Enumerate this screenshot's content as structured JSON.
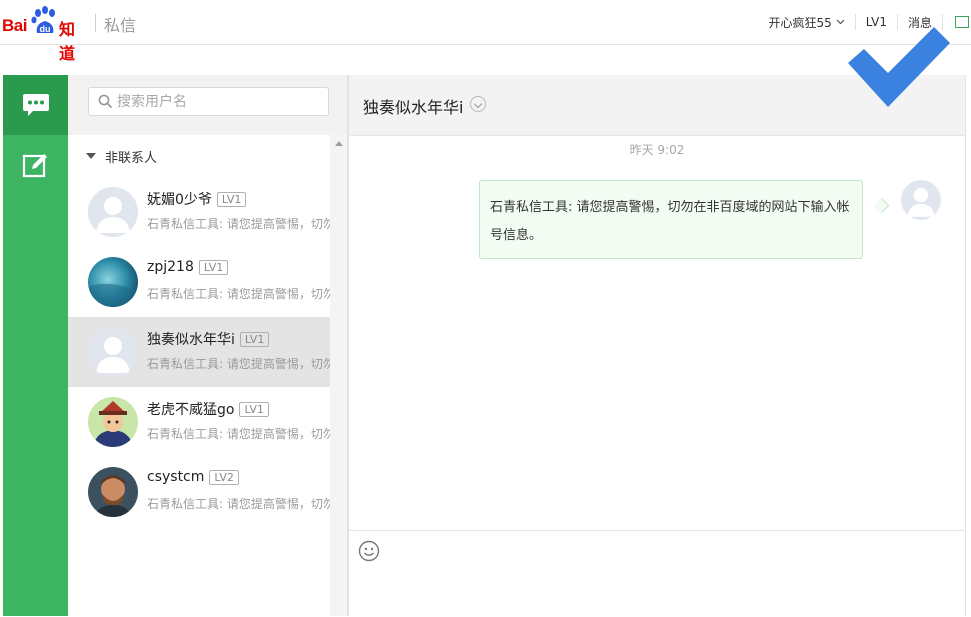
{
  "header": {
    "logo_text_bai": "Bai",
    "logo_text_du": "du",
    "logo_text_zhidao": "知道",
    "section_title": "私信",
    "nav": {
      "username": "开心疯狂55",
      "level": "LV1",
      "messages": "消息"
    }
  },
  "sidebar": {
    "search_placeholder": "搜索用户名",
    "group_label": "非联系人",
    "contacts": [
      {
        "name": "妩媚0少爷",
        "level": "LV1",
        "preview": "石青私信工具: 请您提高警惕，切勿",
        "avatar": "default-avatar"
      },
      {
        "name": "zpj218",
        "level": "LV1",
        "preview": "石青私信工具: 请您提高警惕，切勿",
        "avatar": "blue-photo-avatar"
      },
      {
        "name": "独奏似水年华i",
        "level": "LV1",
        "preview": "石青私信工具: 请您提高警惕，切勿",
        "avatar": "default-avatar"
      },
      {
        "name": "老虎不威猛go",
        "level": "LV1",
        "preview": "石青私信工具: 请您提高警惕，切勿",
        "avatar": "cartoon-avatar"
      },
      {
        "name": "csystcm",
        "level": "LV2",
        "preview": "石青私信工具: 请您提高警惕，切勿",
        "avatar": "photo-avatar"
      }
    ]
  },
  "chat": {
    "title": "独奏似水年华i",
    "timestamp": "昨天 9:02",
    "message": "石青私信工具: 请您提高警惕，切勿在非百度域的网站下输入帐号信息。"
  },
  "colors": {
    "brand_red": "#e10601",
    "rail_green": "#3cb462",
    "rail_active": "#2a9a4c",
    "bubble_bg": "#f2fcf3",
    "bubble_border": "#c3e7c9",
    "overlay_check": "#3b82e0"
  }
}
